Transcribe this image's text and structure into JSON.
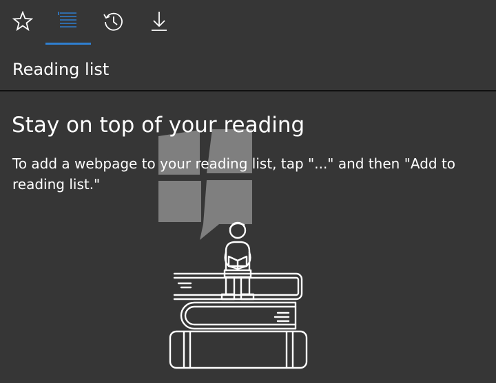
{
  "tabs": [
    {
      "id": "favorites",
      "icon": "star-icon",
      "selected": false
    },
    {
      "id": "reading-list",
      "icon": "reading-list-icon",
      "selected": true
    },
    {
      "id": "history",
      "icon": "history-icon",
      "selected": false
    },
    {
      "id": "downloads",
      "icon": "download-icon",
      "selected": false
    }
  ],
  "pane": {
    "title": "Reading list"
  },
  "empty_state": {
    "heading": "Stay on top of your reading",
    "body": "To add a webpage to your reading list, tap \"...\" and then \"Add to reading list.\""
  },
  "colors": {
    "background": "#363636",
    "accent": "#2f7fd1",
    "text": "#ffffff",
    "divider": "#0f0f0f",
    "watermark": "#8c8c8c"
  }
}
